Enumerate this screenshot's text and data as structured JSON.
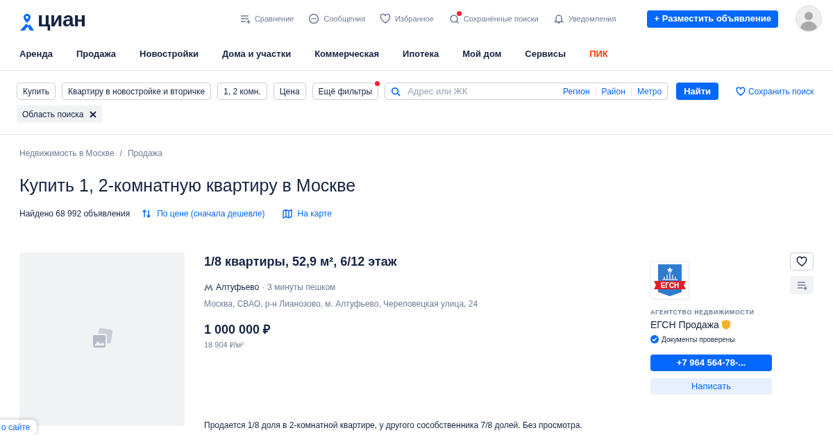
{
  "logo": {
    "text": "циан"
  },
  "top_links": [
    {
      "kind": "compare",
      "label": "Сравнение",
      "dot": false
    },
    {
      "kind": "messages",
      "label": "Сообщения",
      "dot": false
    },
    {
      "kind": "favorites",
      "label": "Избранное",
      "dot": false
    },
    {
      "kind": "saved",
      "label": "Сохранённые поиски",
      "dot": true
    },
    {
      "kind": "notifications",
      "label": "Уведомления",
      "dot": false
    }
  ],
  "post_button": "+ Разместить объявление",
  "nav": [
    {
      "label": "Аренда",
      "kind": "normal"
    },
    {
      "label": "Продажа",
      "kind": "normal"
    },
    {
      "label": "Новостройки",
      "kind": "normal"
    },
    {
      "label": "Дома и участки",
      "kind": "normal"
    },
    {
      "label": "Коммерческая",
      "kind": "normal"
    },
    {
      "label": "Ипотека",
      "kind": "normal"
    },
    {
      "label": "Мой дом",
      "kind": "normal"
    },
    {
      "label": "Сервисы",
      "kind": "normal"
    },
    {
      "label": "ПИК",
      "kind": "brand"
    }
  ],
  "filters": [
    {
      "label": "Купить",
      "dot": false
    },
    {
      "label": "Квартиру в новостройке и вторичке",
      "dot": false
    },
    {
      "label": "1, 2 комн.",
      "dot": false
    },
    {
      "label": "Цена",
      "dot": false
    },
    {
      "label": "Ещё фильтры",
      "dot": true
    }
  ],
  "search": {
    "placeholder": "Адрес или ЖК",
    "links": [
      "Регион",
      "Район",
      "Метро"
    ],
    "button": "Найти",
    "save": "Сохранить поиск"
  },
  "chips": [
    {
      "label": "Область поиска"
    }
  ],
  "breadcrumbs": [
    "Недвижимость в Москве",
    "Продажа"
  ],
  "breadcrumb_separator": "/",
  "title": "Купить 1, 2-комнатную квартиру в Москве",
  "found": "Найдено 68 992 объявления",
  "sort": "По цене (сначала дешевле)",
  "map_link": "На карте",
  "listing": {
    "title": "1/8 квартиры, 52,9 м², 6/12 этаж",
    "metro": "Алтуфьево",
    "walk_separator": "·",
    "walk": "3 минуты пешком",
    "address": "Москва, СВАО, р-н Лианозово, м. Алтуфьево, Череповецкая улица, 24",
    "price": "1 000 000 ₽",
    "price_per_m": "18 904 ₽/м²",
    "description": "Продается 1/8 доля в 2-комнатной квартире, у другого сособственника 7/8 долей. Без просмотра.",
    "agent": {
      "logo_text": "ЕГСН",
      "type": "АГЕНТСТВО НЕДВИЖИМОСТИ",
      "name": "ЕГСН Продажа",
      "verified": "Документы проверены",
      "phone": "+7 964 564-78-...",
      "write": "Написать"
    }
  },
  "feedback": "о сайте"
}
